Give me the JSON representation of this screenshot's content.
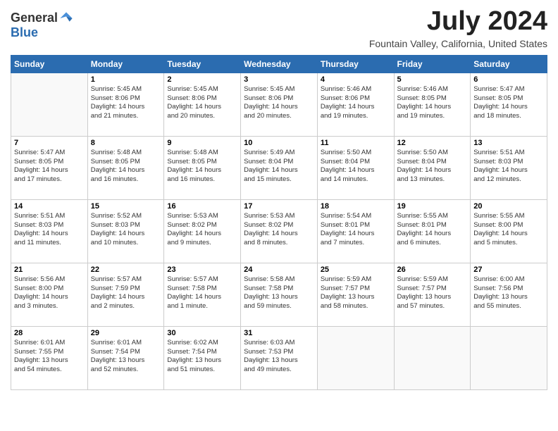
{
  "header": {
    "logo_general": "General",
    "logo_blue": "Blue",
    "title": "July 2024",
    "location": "Fountain Valley, California, United States"
  },
  "days_of_week": [
    "Sunday",
    "Monday",
    "Tuesday",
    "Wednesday",
    "Thursday",
    "Friday",
    "Saturday"
  ],
  "weeks": [
    [
      {
        "day": "",
        "info": ""
      },
      {
        "day": "1",
        "info": "Sunrise: 5:45 AM\nSunset: 8:06 PM\nDaylight: 14 hours\nand 21 minutes."
      },
      {
        "day": "2",
        "info": "Sunrise: 5:45 AM\nSunset: 8:06 PM\nDaylight: 14 hours\nand 20 minutes."
      },
      {
        "day": "3",
        "info": "Sunrise: 5:45 AM\nSunset: 8:06 PM\nDaylight: 14 hours\nand 20 minutes."
      },
      {
        "day": "4",
        "info": "Sunrise: 5:46 AM\nSunset: 8:06 PM\nDaylight: 14 hours\nand 19 minutes."
      },
      {
        "day": "5",
        "info": "Sunrise: 5:46 AM\nSunset: 8:05 PM\nDaylight: 14 hours\nand 19 minutes."
      },
      {
        "day": "6",
        "info": "Sunrise: 5:47 AM\nSunset: 8:05 PM\nDaylight: 14 hours\nand 18 minutes."
      }
    ],
    [
      {
        "day": "7",
        "info": "Sunrise: 5:47 AM\nSunset: 8:05 PM\nDaylight: 14 hours\nand 17 minutes."
      },
      {
        "day": "8",
        "info": "Sunrise: 5:48 AM\nSunset: 8:05 PM\nDaylight: 14 hours\nand 16 minutes."
      },
      {
        "day": "9",
        "info": "Sunrise: 5:48 AM\nSunset: 8:05 PM\nDaylight: 14 hours\nand 16 minutes."
      },
      {
        "day": "10",
        "info": "Sunrise: 5:49 AM\nSunset: 8:04 PM\nDaylight: 14 hours\nand 15 minutes."
      },
      {
        "day": "11",
        "info": "Sunrise: 5:50 AM\nSunset: 8:04 PM\nDaylight: 14 hours\nand 14 minutes."
      },
      {
        "day": "12",
        "info": "Sunrise: 5:50 AM\nSunset: 8:04 PM\nDaylight: 14 hours\nand 13 minutes."
      },
      {
        "day": "13",
        "info": "Sunrise: 5:51 AM\nSunset: 8:03 PM\nDaylight: 14 hours\nand 12 minutes."
      }
    ],
    [
      {
        "day": "14",
        "info": "Sunrise: 5:51 AM\nSunset: 8:03 PM\nDaylight: 14 hours\nand 11 minutes."
      },
      {
        "day": "15",
        "info": "Sunrise: 5:52 AM\nSunset: 8:03 PM\nDaylight: 14 hours\nand 10 minutes."
      },
      {
        "day": "16",
        "info": "Sunrise: 5:53 AM\nSunset: 8:02 PM\nDaylight: 14 hours\nand 9 minutes."
      },
      {
        "day": "17",
        "info": "Sunrise: 5:53 AM\nSunset: 8:02 PM\nDaylight: 14 hours\nand 8 minutes."
      },
      {
        "day": "18",
        "info": "Sunrise: 5:54 AM\nSunset: 8:01 PM\nDaylight: 14 hours\nand 7 minutes."
      },
      {
        "day": "19",
        "info": "Sunrise: 5:55 AM\nSunset: 8:01 PM\nDaylight: 14 hours\nand 6 minutes."
      },
      {
        "day": "20",
        "info": "Sunrise: 5:55 AM\nSunset: 8:00 PM\nDaylight: 14 hours\nand 5 minutes."
      }
    ],
    [
      {
        "day": "21",
        "info": "Sunrise: 5:56 AM\nSunset: 8:00 PM\nDaylight: 14 hours\nand 3 minutes."
      },
      {
        "day": "22",
        "info": "Sunrise: 5:57 AM\nSunset: 7:59 PM\nDaylight: 14 hours\nand 2 minutes."
      },
      {
        "day": "23",
        "info": "Sunrise: 5:57 AM\nSunset: 7:58 PM\nDaylight: 14 hours\nand 1 minute."
      },
      {
        "day": "24",
        "info": "Sunrise: 5:58 AM\nSunset: 7:58 PM\nDaylight: 13 hours\nand 59 minutes."
      },
      {
        "day": "25",
        "info": "Sunrise: 5:59 AM\nSunset: 7:57 PM\nDaylight: 13 hours\nand 58 minutes."
      },
      {
        "day": "26",
        "info": "Sunrise: 5:59 AM\nSunset: 7:57 PM\nDaylight: 13 hours\nand 57 minutes."
      },
      {
        "day": "27",
        "info": "Sunrise: 6:00 AM\nSunset: 7:56 PM\nDaylight: 13 hours\nand 55 minutes."
      }
    ],
    [
      {
        "day": "28",
        "info": "Sunrise: 6:01 AM\nSunset: 7:55 PM\nDaylight: 13 hours\nand 54 minutes."
      },
      {
        "day": "29",
        "info": "Sunrise: 6:01 AM\nSunset: 7:54 PM\nDaylight: 13 hours\nand 52 minutes."
      },
      {
        "day": "30",
        "info": "Sunrise: 6:02 AM\nSunset: 7:54 PM\nDaylight: 13 hours\nand 51 minutes."
      },
      {
        "day": "31",
        "info": "Sunrise: 6:03 AM\nSunset: 7:53 PM\nDaylight: 13 hours\nand 49 minutes."
      },
      {
        "day": "",
        "info": ""
      },
      {
        "day": "",
        "info": ""
      },
      {
        "day": "",
        "info": ""
      }
    ]
  ]
}
